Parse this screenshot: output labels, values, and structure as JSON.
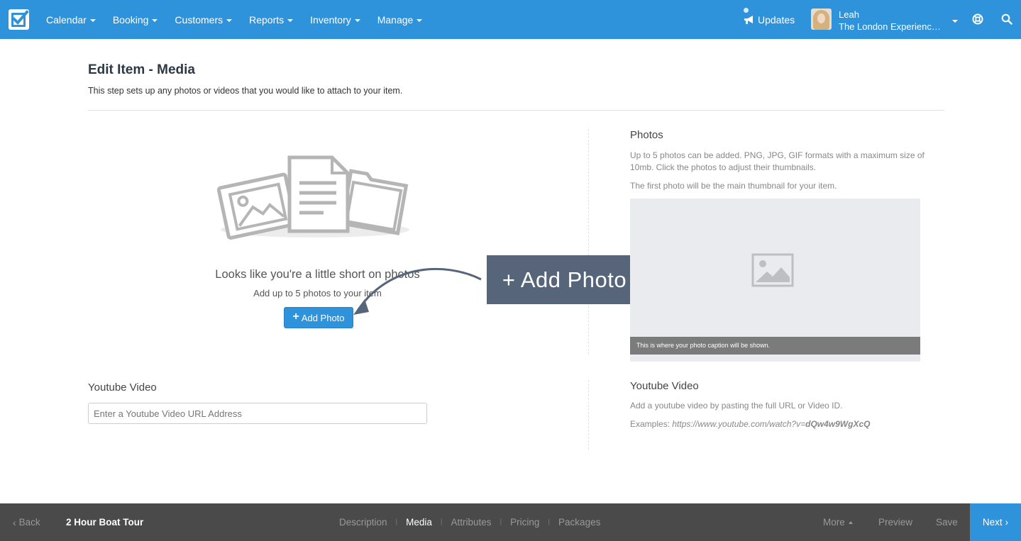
{
  "nav": {
    "items": [
      {
        "label": "Calendar"
      },
      {
        "label": "Booking"
      },
      {
        "label": "Customers"
      },
      {
        "label": "Reports"
      },
      {
        "label": "Inventory"
      },
      {
        "label": "Manage"
      }
    ],
    "updates_label": "Updates",
    "user_name": "Leah",
    "user_org": "The London Experienc…"
  },
  "header": {
    "title": "Edit Item - Media",
    "subtitle": "This step sets up any photos or videos that you would like to attach to your item."
  },
  "empty_state": {
    "title": "Looks like you're a little short on photos",
    "subtitle": "Add up to 5 photos to your item",
    "button_label": "Add Photo"
  },
  "callout": {
    "text": "+ Add Photo"
  },
  "photos_panel": {
    "title": "Photos",
    "description": "Up to 5 photos can be added. PNG, JPG, GIF formats with a maximum size of 10mb. Click the photos to adjust their thumbnails.",
    "note": "The first photo will be the main thumbnail for your item.",
    "caption_placeholder": "This is where your photo caption will be shown."
  },
  "youtube": {
    "label": "Youtube Video",
    "placeholder": "Enter a Youtube Video URL Address",
    "value": "",
    "help_title": "Youtube Video",
    "help_desc": "Add a youtube video by pasting the full URL or Video ID.",
    "examples_label": "Examples: ",
    "example_url": "https://www.youtube.com/watch?v=",
    "example_id": "dQw4w9WgXcQ"
  },
  "bottombar": {
    "back_label": "Back",
    "item_name": "2 Hour Boat Tour",
    "tabs": [
      {
        "label": "Description",
        "active": false
      },
      {
        "label": "Media",
        "active": true
      },
      {
        "label": "Attributes",
        "active": false
      },
      {
        "label": "Pricing",
        "active": false
      },
      {
        "label": "Packages",
        "active": false
      }
    ],
    "more_label": "More",
    "preview_label": "Preview",
    "save_label": "Save",
    "next_label": "Next"
  },
  "colors": {
    "primary": "#2f93db",
    "bottombar": "#4a4a4a",
    "callout": "#56657a"
  },
  "icons": [
    "check-logo-icon",
    "megaphone-icon",
    "help-lifebuoy-icon",
    "search-icon",
    "image-placeholder-icon",
    "chevron-left-icon",
    "chevron-right-icon"
  ]
}
